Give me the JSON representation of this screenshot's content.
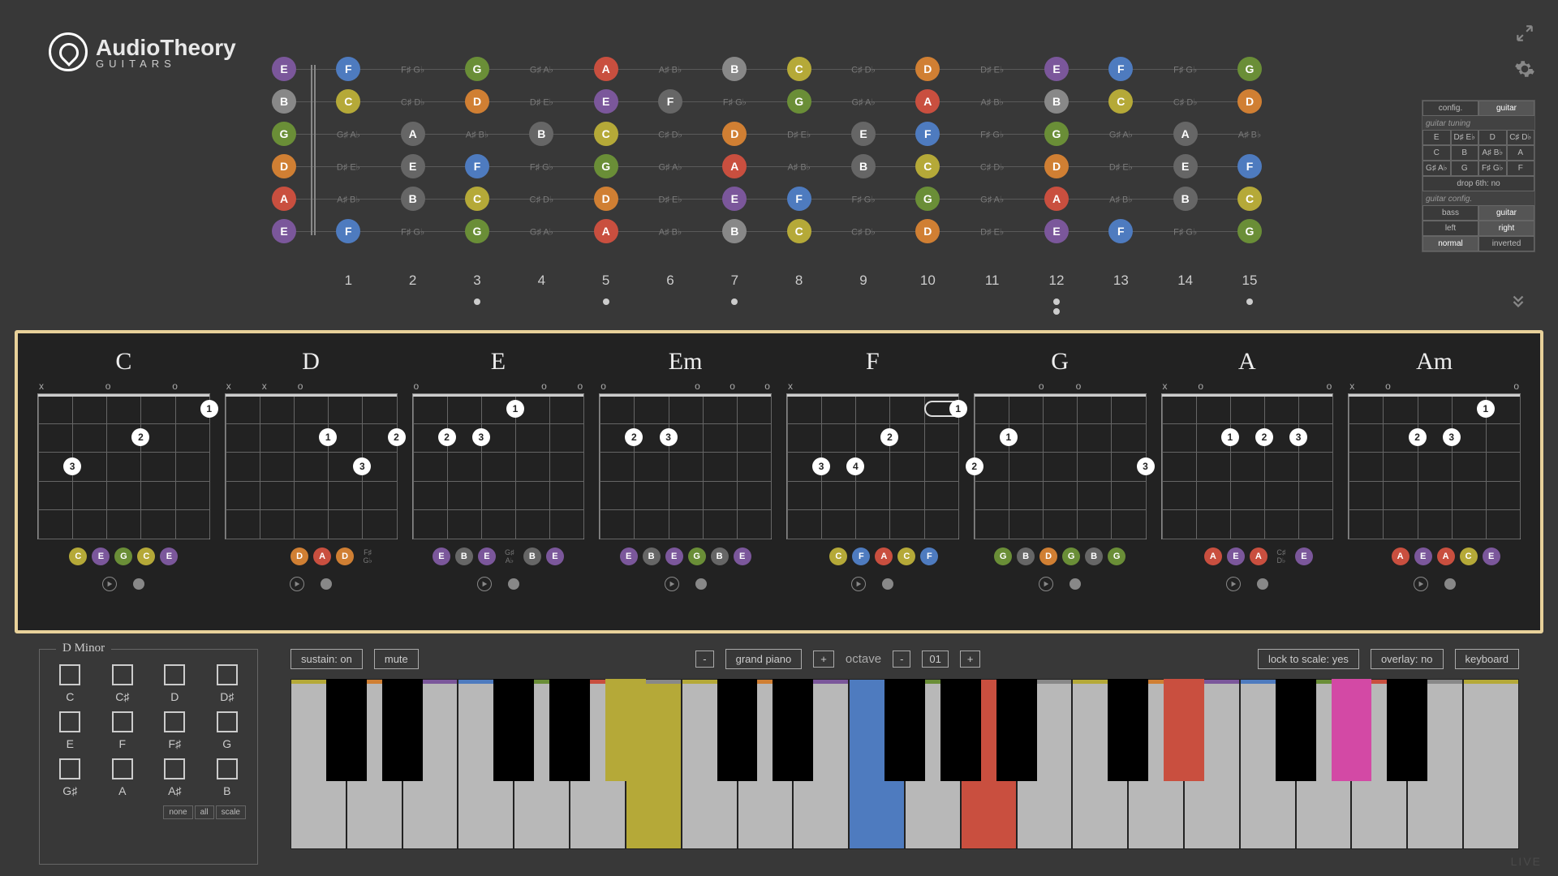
{
  "app": {
    "title_main": "AudioTheory",
    "title_sub": "GUITARS"
  },
  "topIcons": {
    "expand": "expand-icon",
    "gear": "gear-icon"
  },
  "noteColors": {
    "A": "#c94f3f",
    "B": "#888888",
    "C": "#b5a938",
    "D": "#d07f33",
    "E": "#7b579b",
    "F": "#4e7bbf",
    "G": "#6a8e37"
  },
  "fretboard": {
    "strings": [
      [
        "E",
        "F",
        "F♯ G♭",
        "G",
        "G♯ A♭",
        "A",
        "A♯ B♭",
        "B",
        "C",
        "C♯ D♭",
        "D",
        "D♯ E♭",
        "E",
        "F",
        "F♯ G♭",
        "G"
      ],
      [
        "B",
        "C",
        "C♯ D♭",
        "D",
        "D♯ E♭",
        "E",
        "F",
        "F♯ G♭",
        "G",
        "G♯ A♭",
        "A",
        "A♯ B♭",
        "B",
        "C",
        "C♯ D♭",
        "D"
      ],
      [
        "G",
        "G♯ A♭",
        "A",
        "A♯ B♭",
        "B",
        "C",
        "C♯ D♭",
        "D",
        "D♯ E♭",
        "E",
        "F",
        "F♯ G♭",
        "G",
        "G♯ A♭",
        "A",
        "A♯ B♭"
      ],
      [
        "D",
        "D♯ E♭",
        "E",
        "F",
        "F♯ G♭",
        "G",
        "G♯ A♭",
        "A",
        "A♯ B♭",
        "B",
        "C",
        "C♯ D♭",
        "D",
        "D♯ E♭",
        "E",
        "F"
      ],
      [
        "A",
        "A♯ B♭",
        "B",
        "C",
        "C♯ D♭",
        "D",
        "D♯ E♭",
        "E",
        "F",
        "F♯ G♭",
        "G",
        "G♯ A♭",
        "A",
        "A♯ B♭",
        "B",
        "C"
      ],
      [
        "E",
        "F",
        "F♯ G♭",
        "G",
        "G♯ A♭",
        "A",
        "A♯ B♭",
        "B",
        "C",
        "C♯ D♭",
        "D",
        "D♯ E♭",
        "E",
        "F",
        "F♯ G♭",
        "G"
      ]
    ],
    "circleCols": [
      0,
      1,
      3,
      5,
      7,
      8,
      10,
      12,
      13,
      15
    ],
    "fretNumbers": [
      "1",
      "2",
      "3",
      "4",
      "5",
      "6",
      "7",
      "8",
      "9",
      "10",
      "11",
      "12",
      "13",
      "14",
      "15"
    ],
    "dots": [
      3,
      5,
      7,
      15
    ],
    "doubleDot": 12
  },
  "config": {
    "tabs": [
      "config.",
      "guitar"
    ],
    "tabs_sel": 1,
    "tuning_hdr": "guitar tuning",
    "tuning": [
      [
        "E",
        "D♯ E♭",
        "D",
        "C♯ D♭"
      ],
      [
        "C",
        "B",
        "A♯ B♭",
        "A"
      ],
      [
        "G♯ A♭",
        "G",
        "F♯ G♭",
        "F"
      ]
    ],
    "drop": "drop 6th: no",
    "config_hdr": "guitar config.",
    "rows": [
      [
        "bass",
        "guitar",
        1
      ],
      [
        "left",
        "right",
        1
      ],
      [
        "normal",
        "inverted",
        0
      ]
    ]
  },
  "chords": [
    {
      "name": "C",
      "open": [
        "x",
        "",
        "o",
        "",
        "o",
        ""
      ],
      "fingers": [
        [
          5,
          1,
          "1"
        ],
        [
          3,
          2,
          "2"
        ],
        [
          1,
          3,
          "3"
        ]
      ],
      "notes": [
        "C",
        "E",
        "G",
        "C",
        "E"
      ],
      "noteMuted": [
        false,
        false,
        false,
        false,
        false
      ]
    },
    {
      "name": "D",
      "open": [
        "x",
        "x",
        "o",
        "",
        "",
        ""
      ],
      "fingers": [
        [
          3,
          2,
          "1"
        ],
        [
          5,
          2,
          "2"
        ],
        [
          4,
          3,
          "3"
        ]
      ],
      "notes": [
        "D",
        "A",
        "D",
        "F♯ G♭"
      ],
      "noteMuted": [
        false,
        false,
        false,
        true
      ],
      "offset": 2
    },
    {
      "name": "E",
      "open": [
        "o",
        "",
        "",
        "",
        "o",
        "o"
      ],
      "fingers": [
        [
          3,
          1,
          "1"
        ],
        [
          1,
          2,
          "2"
        ],
        [
          2,
          2,
          "3"
        ]
      ],
      "notes": [
        "E",
        "B",
        "E",
        "G♯ A♭",
        "B",
        "E"
      ],
      "noteMuted": [
        false,
        true,
        false,
        true,
        true,
        false
      ]
    },
    {
      "name": "Em",
      "open": [
        "o",
        "",
        "",
        "o",
        "o",
        "o"
      ],
      "fingers": [
        [
          1,
          2,
          "2"
        ],
        [
          2,
          2,
          "3"
        ]
      ],
      "notes": [
        "E",
        "B",
        "E",
        "G",
        "B",
        "E"
      ],
      "noteMuted": [
        false,
        true,
        false,
        false,
        true,
        false
      ]
    },
    {
      "name": "F",
      "open": [
        "x",
        "",
        "",
        "",
        "",
        ""
      ],
      "fingers": [
        [
          5,
          1,
          "1"
        ],
        [
          3,
          2,
          "2"
        ],
        [
          1,
          3,
          "3"
        ],
        [
          2,
          3,
          "4"
        ]
      ],
      "barre": [
        4,
        5,
        1
      ],
      "notes": [
        "C",
        "F",
        "A",
        "C",
        "F"
      ],
      "noteMuted": [
        false,
        false,
        false,
        false,
        false
      ],
      "offset": 1
    },
    {
      "name": "G",
      "open": [
        "",
        "",
        "o",
        "o",
        "",
        ""
      ],
      "fingers": [
        [
          1,
          2,
          "1"
        ],
        [
          0,
          3,
          "2"
        ],
        [
          5,
          3,
          "3"
        ]
      ],
      "notes": [
        "G",
        "B",
        "D",
        "G",
        "B",
        "G"
      ],
      "noteMuted": [
        false,
        true,
        false,
        false,
        true,
        false
      ]
    },
    {
      "name": "A",
      "open": [
        "x",
        "o",
        "",
        "",
        "",
        "o"
      ],
      "fingers": [
        [
          2,
          2,
          "1"
        ],
        [
          3,
          2,
          "2"
        ],
        [
          4,
          2,
          "3"
        ]
      ],
      "notes": [
        "A",
        "E",
        "A",
        "C♯ D♭",
        "E"
      ],
      "noteMuted": [
        false,
        false,
        false,
        true,
        false
      ],
      "offset": 1
    },
    {
      "name": "Am",
      "open": [
        "x",
        "o",
        "",
        "",
        "",
        "o"
      ],
      "fingers": [
        [
          4,
          1,
          "1"
        ],
        [
          2,
          2,
          "2"
        ],
        [
          3,
          2,
          "3"
        ]
      ],
      "notes": [
        "A",
        "E",
        "A",
        "C",
        "E"
      ],
      "noteMuted": [
        false,
        false,
        false,
        false,
        false
      ],
      "offset": 1
    }
  ],
  "scale": {
    "title": "D Minor",
    "cells": [
      [
        "C",
        false
      ],
      [
        "C♯",
        false
      ],
      [
        "D",
        false
      ],
      [
        "D♯",
        false
      ],
      [
        "E",
        false
      ],
      [
        "F",
        false
      ],
      [
        "F♯",
        false
      ],
      [
        "G",
        false
      ],
      [
        "G♯",
        false
      ],
      [
        "A",
        false
      ],
      [
        "A♯",
        false
      ],
      [
        "B",
        false
      ]
    ],
    "buttons": [
      "none",
      "all",
      "scale"
    ]
  },
  "kbd": {
    "sustain": "sustain: on",
    "mute": "mute",
    "instrument": "grand piano",
    "octave_lbl": "octave",
    "octave_val": "01",
    "lock": "lock to scale: yes",
    "overlay": "overlay: no",
    "keyboard": "keyboard",
    "whites_pattern": [
      "C",
      "D",
      "E",
      "F",
      "G",
      "A",
      "B"
    ],
    "octaves": 3,
    "extra": 1,
    "highlights": {
      "C": "#b5a938",
      "D": "#d07f33",
      "E": "#7b579b",
      "F": "#4e7bbf",
      "G": "#6a8e37",
      "A": "#c94f3f",
      "B": "#888888"
    },
    "coloredWhites": {
      "6": "#b5a938",
      "10": "#4e7bbf",
      "12": "#c94f3f"
    },
    "coloredBlacks": {
      "4": "#b5a938",
      "11": "#c94f3f",
      "13": "#d349a5"
    }
  },
  "live": "LIVE"
}
